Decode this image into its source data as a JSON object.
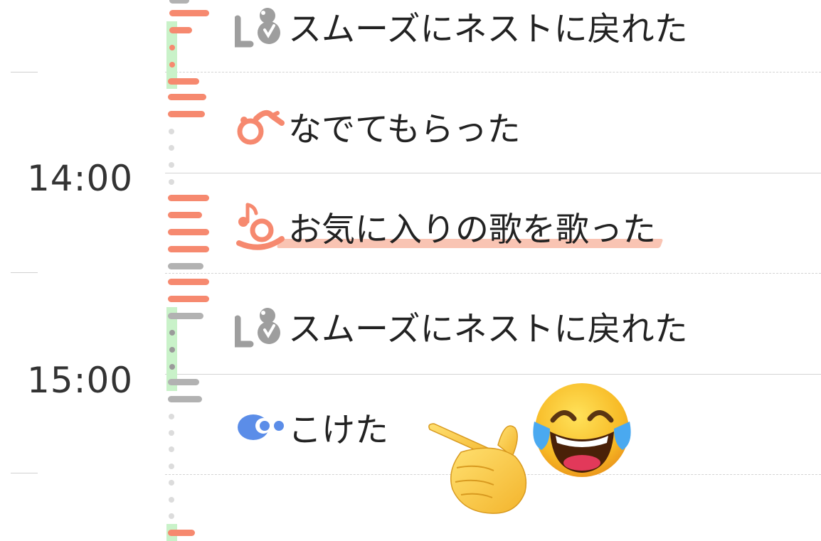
{
  "timeline": {
    "hour_labels": [
      "14:00",
      "15:00"
    ],
    "events": [
      {
        "text": "スムーズにネストに戻れた",
        "icon": "nest-return-icon",
        "color": "#9e9e9e"
      },
      {
        "text": "なでてもらった",
        "icon": "petting-hand-icon",
        "color": "#f6896f"
      },
      {
        "text": "お気に入りの歌を歌った",
        "icon": "singing-bird-icon",
        "color": "#f6896f",
        "highlighted": true
      },
      {
        "text": "スムーズにネストに戻れた",
        "icon": "nest-return-icon",
        "color": "#9e9e9e"
      },
      {
        "text": "こけた",
        "icon": "fall-cloud-icon",
        "color": "#5b8de8"
      }
    ]
  },
  "overlays": {
    "emoji_1": "face-with-tears-of-joy",
    "emoji_2": "backhand-index-pointing-left"
  },
  "colors": {
    "orange": "#f6896f",
    "gray": "#b2b2b2",
    "green": "#c9f2c9",
    "blue": "#5b8de8",
    "highlight": "#f9c4b3"
  }
}
